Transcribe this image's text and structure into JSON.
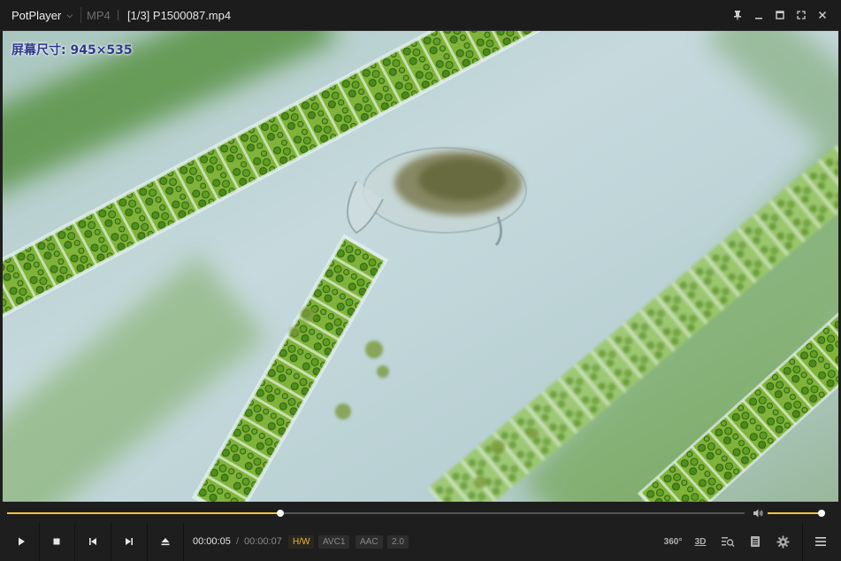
{
  "titlebar": {
    "app_name": "PotPlayer",
    "format": "MP4",
    "file_title": "[1/3] P1500087.mp4",
    "buttons": [
      "pin-icon",
      "minimize-icon",
      "maximize-icon",
      "fullscreen-icon",
      "close-icon"
    ]
  },
  "video": {
    "osd_text": "屏幕尺寸: 945×535"
  },
  "playback": {
    "progress": 0.37,
    "volume": 0.95,
    "current_time": "00:00:05",
    "separator": "/",
    "total_time": "00:00:07"
  },
  "badges": {
    "decoder": "H/W",
    "video_codec": "AVC1",
    "audio_codec": "AAC",
    "audio_channels": "2.0"
  },
  "right_controls": {
    "vr_label": "360°",
    "stereo_label": "3D"
  },
  "colors": {
    "accent": "#f3c43a",
    "background": "#1e1e1e",
    "titlebar": "#1c1c1c"
  }
}
